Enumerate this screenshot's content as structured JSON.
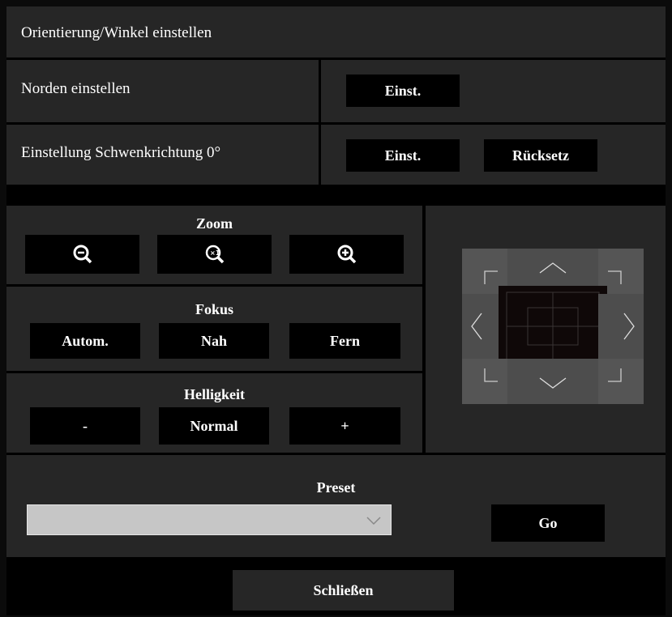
{
  "header": {
    "title": "Orientierung/Winkel einstellen"
  },
  "north_row": {
    "label": "Norden einstellen",
    "set_button": "Einst."
  },
  "pan_row": {
    "label": "Einstellung Schwenkrichtung 0°",
    "set_button": "Einst.",
    "reset_button": "Rücksetz"
  },
  "zoom": {
    "title": "Zoom",
    "icons": [
      "zoom-out-icon",
      "zoom-x1-icon",
      "zoom-in-icon"
    ]
  },
  "focus": {
    "title": "Fokus",
    "auto_button": "Autom.",
    "near_button": "Nah",
    "far_button": "Fern"
  },
  "brightness": {
    "title": "Helligkeit",
    "minus_button": "-",
    "normal_button": "Normal",
    "plus_button": "+"
  },
  "preset": {
    "title": "Preset",
    "selected": "",
    "go_button": "Go"
  },
  "footer": {
    "close_button": "Schließen"
  },
  "colors": {
    "panel": "#262626",
    "button": "#000000",
    "pad": "#555555"
  }
}
